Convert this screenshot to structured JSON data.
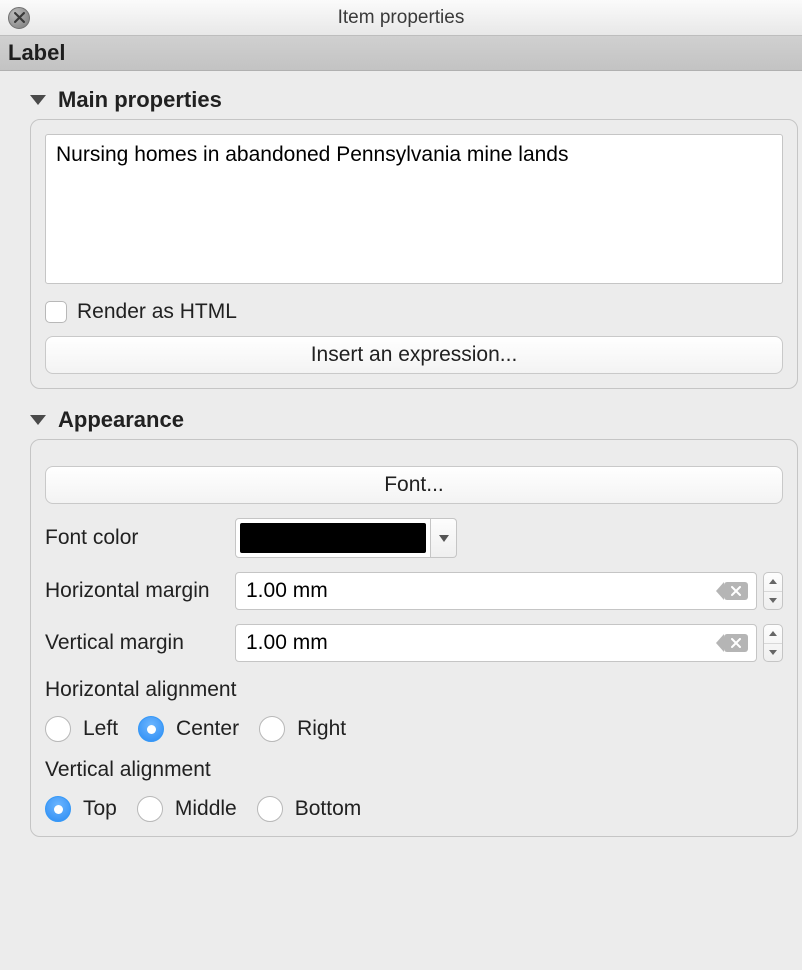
{
  "window": {
    "title": "Item properties",
    "tab_label": "Label"
  },
  "sections": {
    "main": {
      "title": "Main properties",
      "label_text": "Nursing homes in abandoned Pennsylvania mine lands",
      "render_html_label": "Render as HTML",
      "insert_expr_label": "Insert an expression..."
    },
    "appearance": {
      "title": "Appearance",
      "font_button": "Font...",
      "font_color_label": "Font color",
      "font_color_value": "#000000",
      "hmargin_label": "Horizontal margin",
      "hmargin_value": "1.00 mm",
      "vmargin_label": "Vertical margin",
      "vmargin_value": "1.00 mm",
      "halign_label": "Horizontal alignment",
      "halign_options": {
        "left": "Left",
        "center": "Center",
        "right": "Right"
      },
      "halign_selected": "center",
      "valign_label": "Vertical alignment",
      "valign_options": {
        "top": "Top",
        "middle": "Middle",
        "bottom": "Bottom"
      },
      "valign_selected": "top"
    }
  }
}
